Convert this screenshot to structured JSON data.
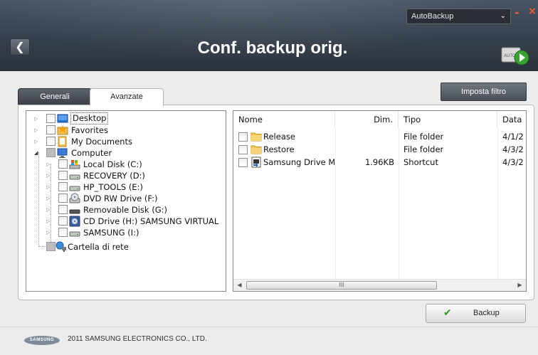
{
  "header": {
    "title": "Conf. backup orig.",
    "mode_selected": "AutoBackup",
    "min_label": "-",
    "close_label": "×",
    "auto_icon_text": "AUTO"
  },
  "tabs": [
    {
      "label": "Generali",
      "active": false
    },
    {
      "label": "Avanzate",
      "active": true
    }
  ],
  "filter_button": "Imposta filtro",
  "tree": {
    "items": [
      {
        "label": "Desktop",
        "icon": "desktop-icon"
      },
      {
        "label": "Favorites",
        "icon": "star-folder-icon"
      },
      {
        "label": "My Documents",
        "icon": "documents-icon"
      },
      {
        "label": "Computer",
        "icon": "computer-icon"
      },
      {
        "label": "Local Disk (C:)",
        "icon": "hard-disk-icon"
      },
      {
        "label": "RECOVERY (D:)",
        "icon": "drive-icon"
      },
      {
        "label": "HP_TOOLS (E:)",
        "icon": "drive-icon"
      },
      {
        "label": "DVD RW Drive (F:)",
        "icon": "dvd-drive-icon"
      },
      {
        "label": "Removable Disk (G:)",
        "icon": "removable-disk-icon"
      },
      {
        "label": "CD Drive (H:) SAMSUNG VIRTUAL",
        "icon": "cd-drive-icon"
      },
      {
        "label": "SAMSUNG (I:)",
        "icon": "drive-icon"
      },
      {
        "label": "Cartella di rete",
        "icon": "network-icon"
      }
    ]
  },
  "file_list": {
    "columns": [
      "Nome",
      "Dim.",
      "Tipo",
      "Data"
    ],
    "rows": [
      {
        "name": "Release",
        "size": "",
        "type": "File folder",
        "date": "4/1/2",
        "icon": "folder-icon"
      },
      {
        "name": "Restore",
        "size": "",
        "type": "File folder",
        "date": "4/3/2",
        "icon": "folder-icon"
      },
      {
        "name": "Samsung Drive Ma...",
        "size": "1.96KB",
        "type": "Shortcut",
        "date": "4/3/2",
        "icon": "shortcut-icon"
      }
    ],
    "scroll_grip": "III"
  },
  "backup_button": "Backup",
  "footer": {
    "logo_text": "SAMSUNG",
    "copyright": "2011 SAMSUNG ELECTRONICS CO., LTD."
  },
  "colors": {
    "header_bg": "#3b4553",
    "accent_orange": "#ff5b2e",
    "check_green": "#2e9a22"
  }
}
